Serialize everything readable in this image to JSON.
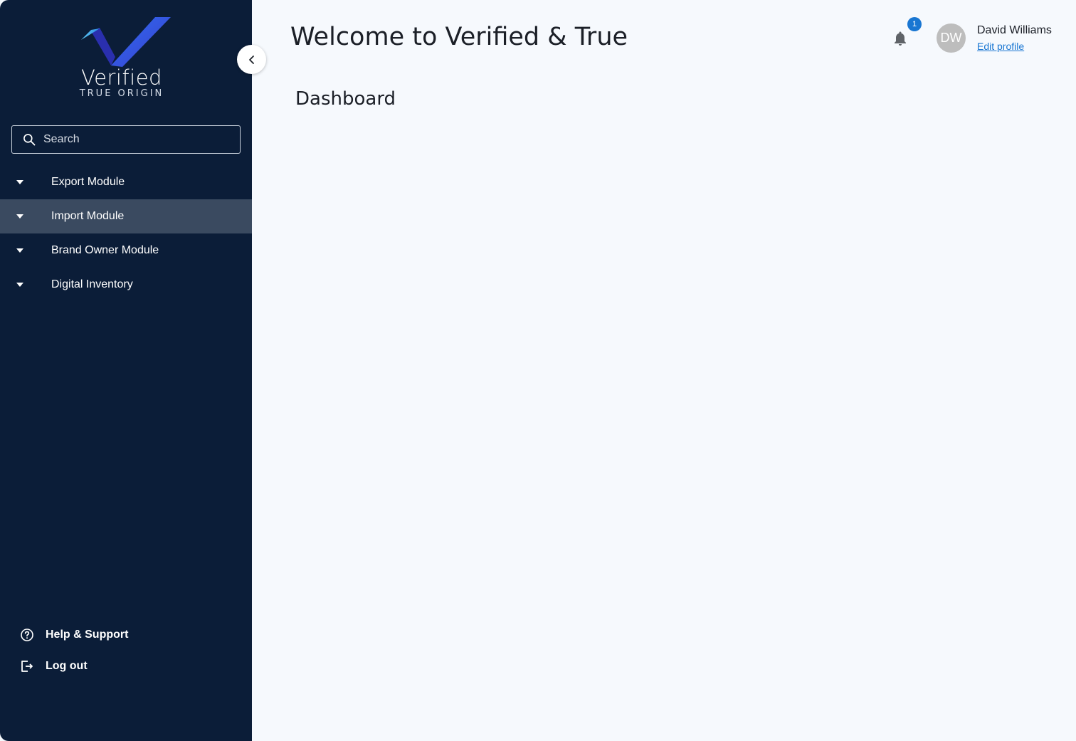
{
  "brand": {
    "name": "Verified",
    "tagline": "TRUE ORIGIN"
  },
  "search": {
    "placeholder": "Search",
    "value": ""
  },
  "sidebar": {
    "items": [
      {
        "label": "Export Module",
        "active": false
      },
      {
        "label": "Import Module",
        "active": true
      },
      {
        "label": "Brand Owner Module",
        "active": false
      },
      {
        "label": "Digital Inventory",
        "active": false
      }
    ],
    "help_label": "Help & Support",
    "logout_label": "Log out"
  },
  "header": {
    "title": "Welcome to Verified & True",
    "notification_count": "1",
    "user": {
      "initials": "DW",
      "name": "David Williams",
      "edit_label": "Edit profile"
    }
  },
  "main": {
    "section_title": "Dashboard"
  },
  "icons": {
    "search": "search-icon",
    "collapse": "chevron-left-icon",
    "caret": "caret-down-icon",
    "help": "help-circle-icon",
    "logout": "logout-icon",
    "bell": "bell-icon"
  },
  "colors": {
    "sidebar_bg": "#0b1d38",
    "active_item_bg": "#3a4a60",
    "page_bg": "#f6f9fd",
    "accent": "#1976d2",
    "avatar_bg": "#bdbdbd"
  }
}
